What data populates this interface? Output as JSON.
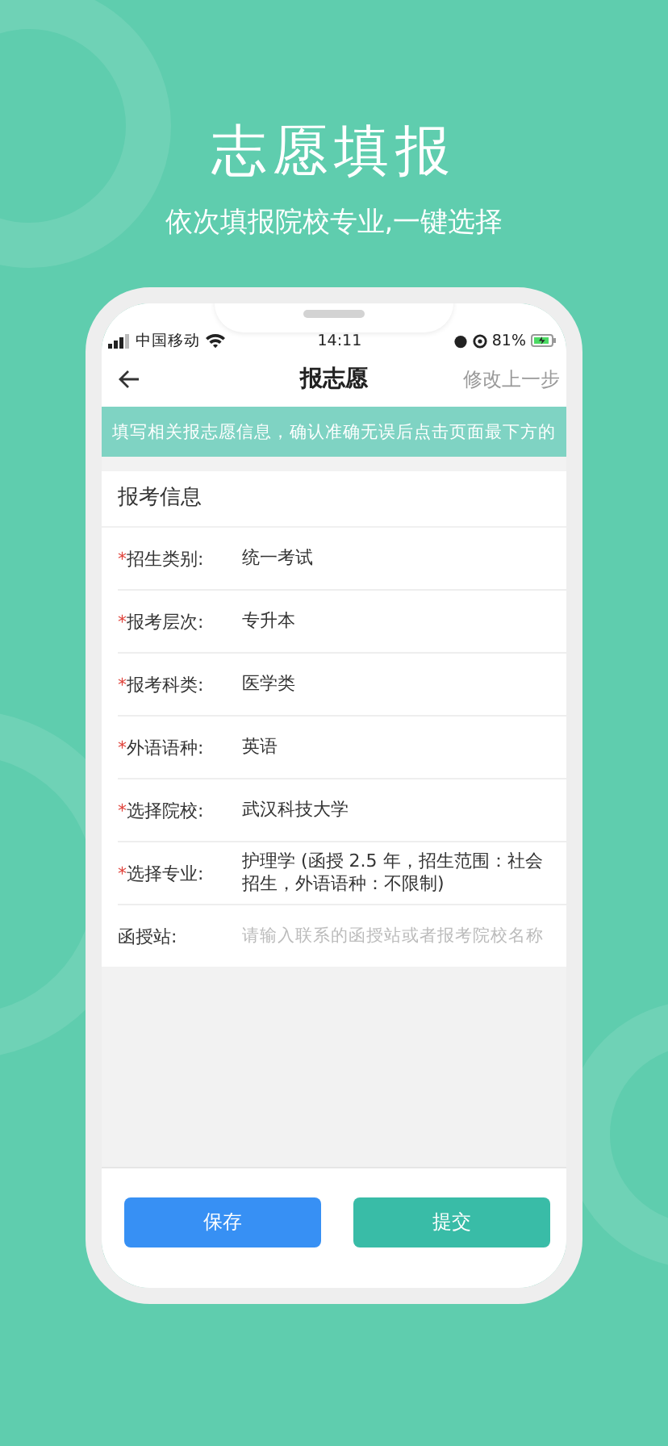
{
  "headline": "志愿填报",
  "subheadline": "依次填报院校专业,一键选择",
  "status_bar": {
    "carrier": "中国移动",
    "time": "14:11",
    "battery": "81%"
  },
  "nav": {
    "title": "报志愿",
    "action": "修改上一步"
  },
  "notice": "填写相关报志愿信息，确认准确无误后点击页面最下方的",
  "section_title": "报考信息",
  "fields": [
    {
      "mark": "*",
      "label": "招生类别:",
      "value": "统一考试"
    },
    {
      "mark": "*",
      "label": "报考层次:",
      "value": "专升本"
    },
    {
      "mark": "*",
      "label": "报考科类:",
      "value": "医学类"
    },
    {
      "mark": "*",
      "label": "外语语种:",
      "value": "英语"
    },
    {
      "mark": "*",
      "label": "选择院校:",
      "value": "武汉科技大学"
    },
    {
      "mark": "*",
      "label": "选择专业:",
      "value": "护理学 (函授 2.5 年，招生范围：社会招生，外语语种：不限制)"
    },
    {
      "label": "函授站:",
      "placeholder": "请输入联系的函授站或者报考院校名称"
    }
  ],
  "buttons": [
    {
      "label": "保存",
      "kind": "secondary"
    },
    {
      "label": "提交",
      "kind": "primary"
    }
  ]
}
